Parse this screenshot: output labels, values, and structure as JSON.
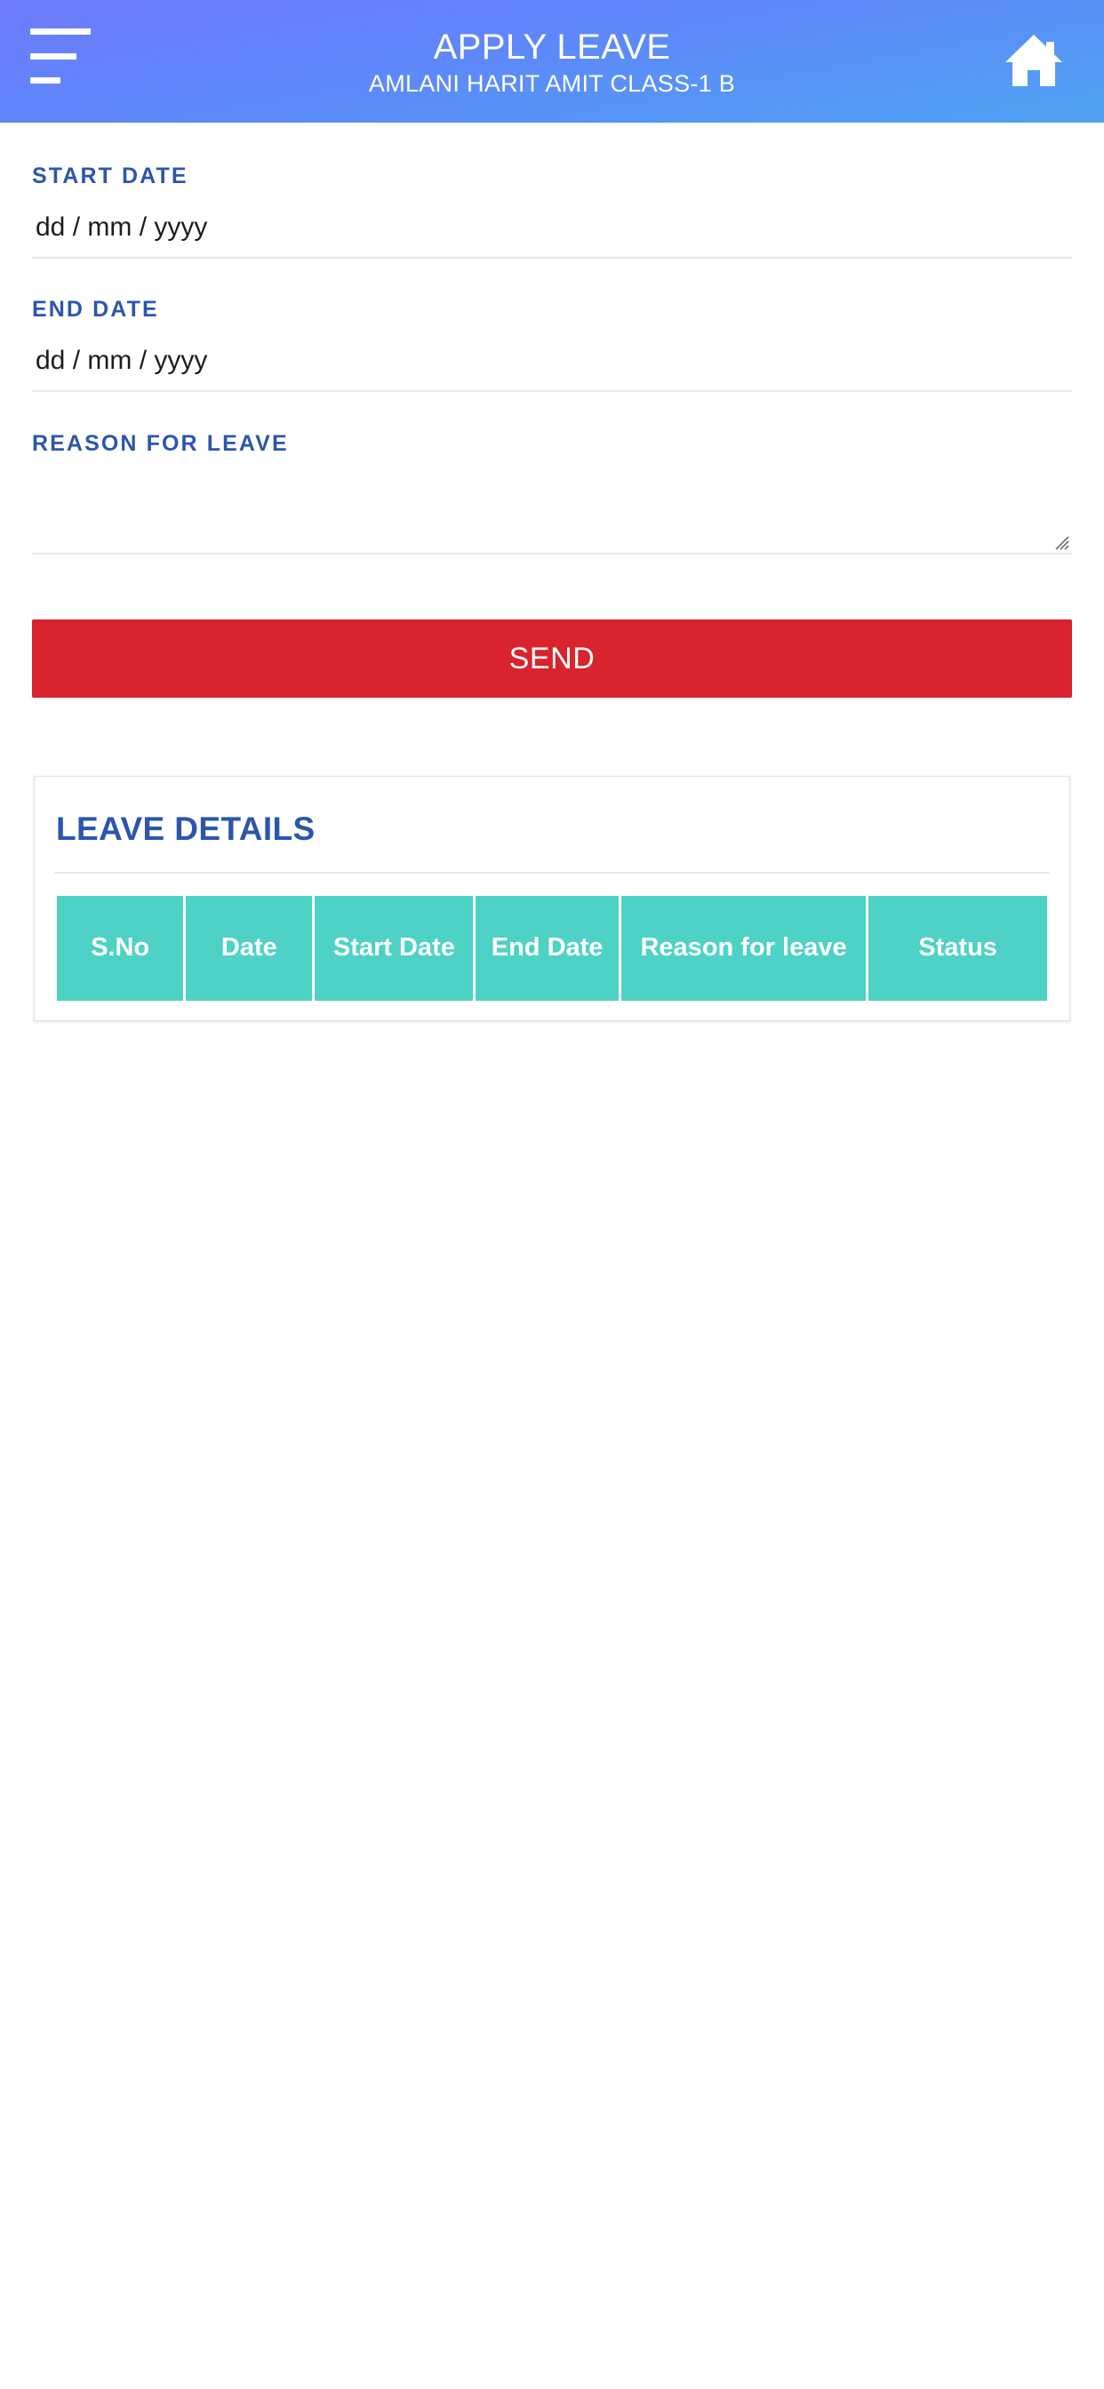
{
  "header": {
    "title": "APPLY LEAVE",
    "subtitle": "AMLANI HARIT AMIT CLASS-1 B",
    "menu_icon": "hamburger-menu-icon",
    "home_icon": "home-icon",
    "gradient_from": "#6E7BFB",
    "gradient_to": "#4FA3F3"
  },
  "form": {
    "start_date": {
      "label": "START DATE",
      "placeholder": "dd / mm / yyyy",
      "value": ""
    },
    "end_date": {
      "label": "END DATE",
      "placeholder": "dd / mm / yyyy",
      "value": ""
    },
    "reason": {
      "label": "REASON FOR LEAVE",
      "placeholder": "",
      "value": ""
    },
    "submit_label": "SEND",
    "submit_color": "#D9232D",
    "label_color": "#2B56AD"
  },
  "leave_details": {
    "title": "LEAVE DETAILS",
    "header_color": "#4ED2C6",
    "columns": [
      "S.No",
      "Date",
      "Start Date",
      "End Date",
      "Reason for leave",
      "Status"
    ],
    "rows": []
  }
}
